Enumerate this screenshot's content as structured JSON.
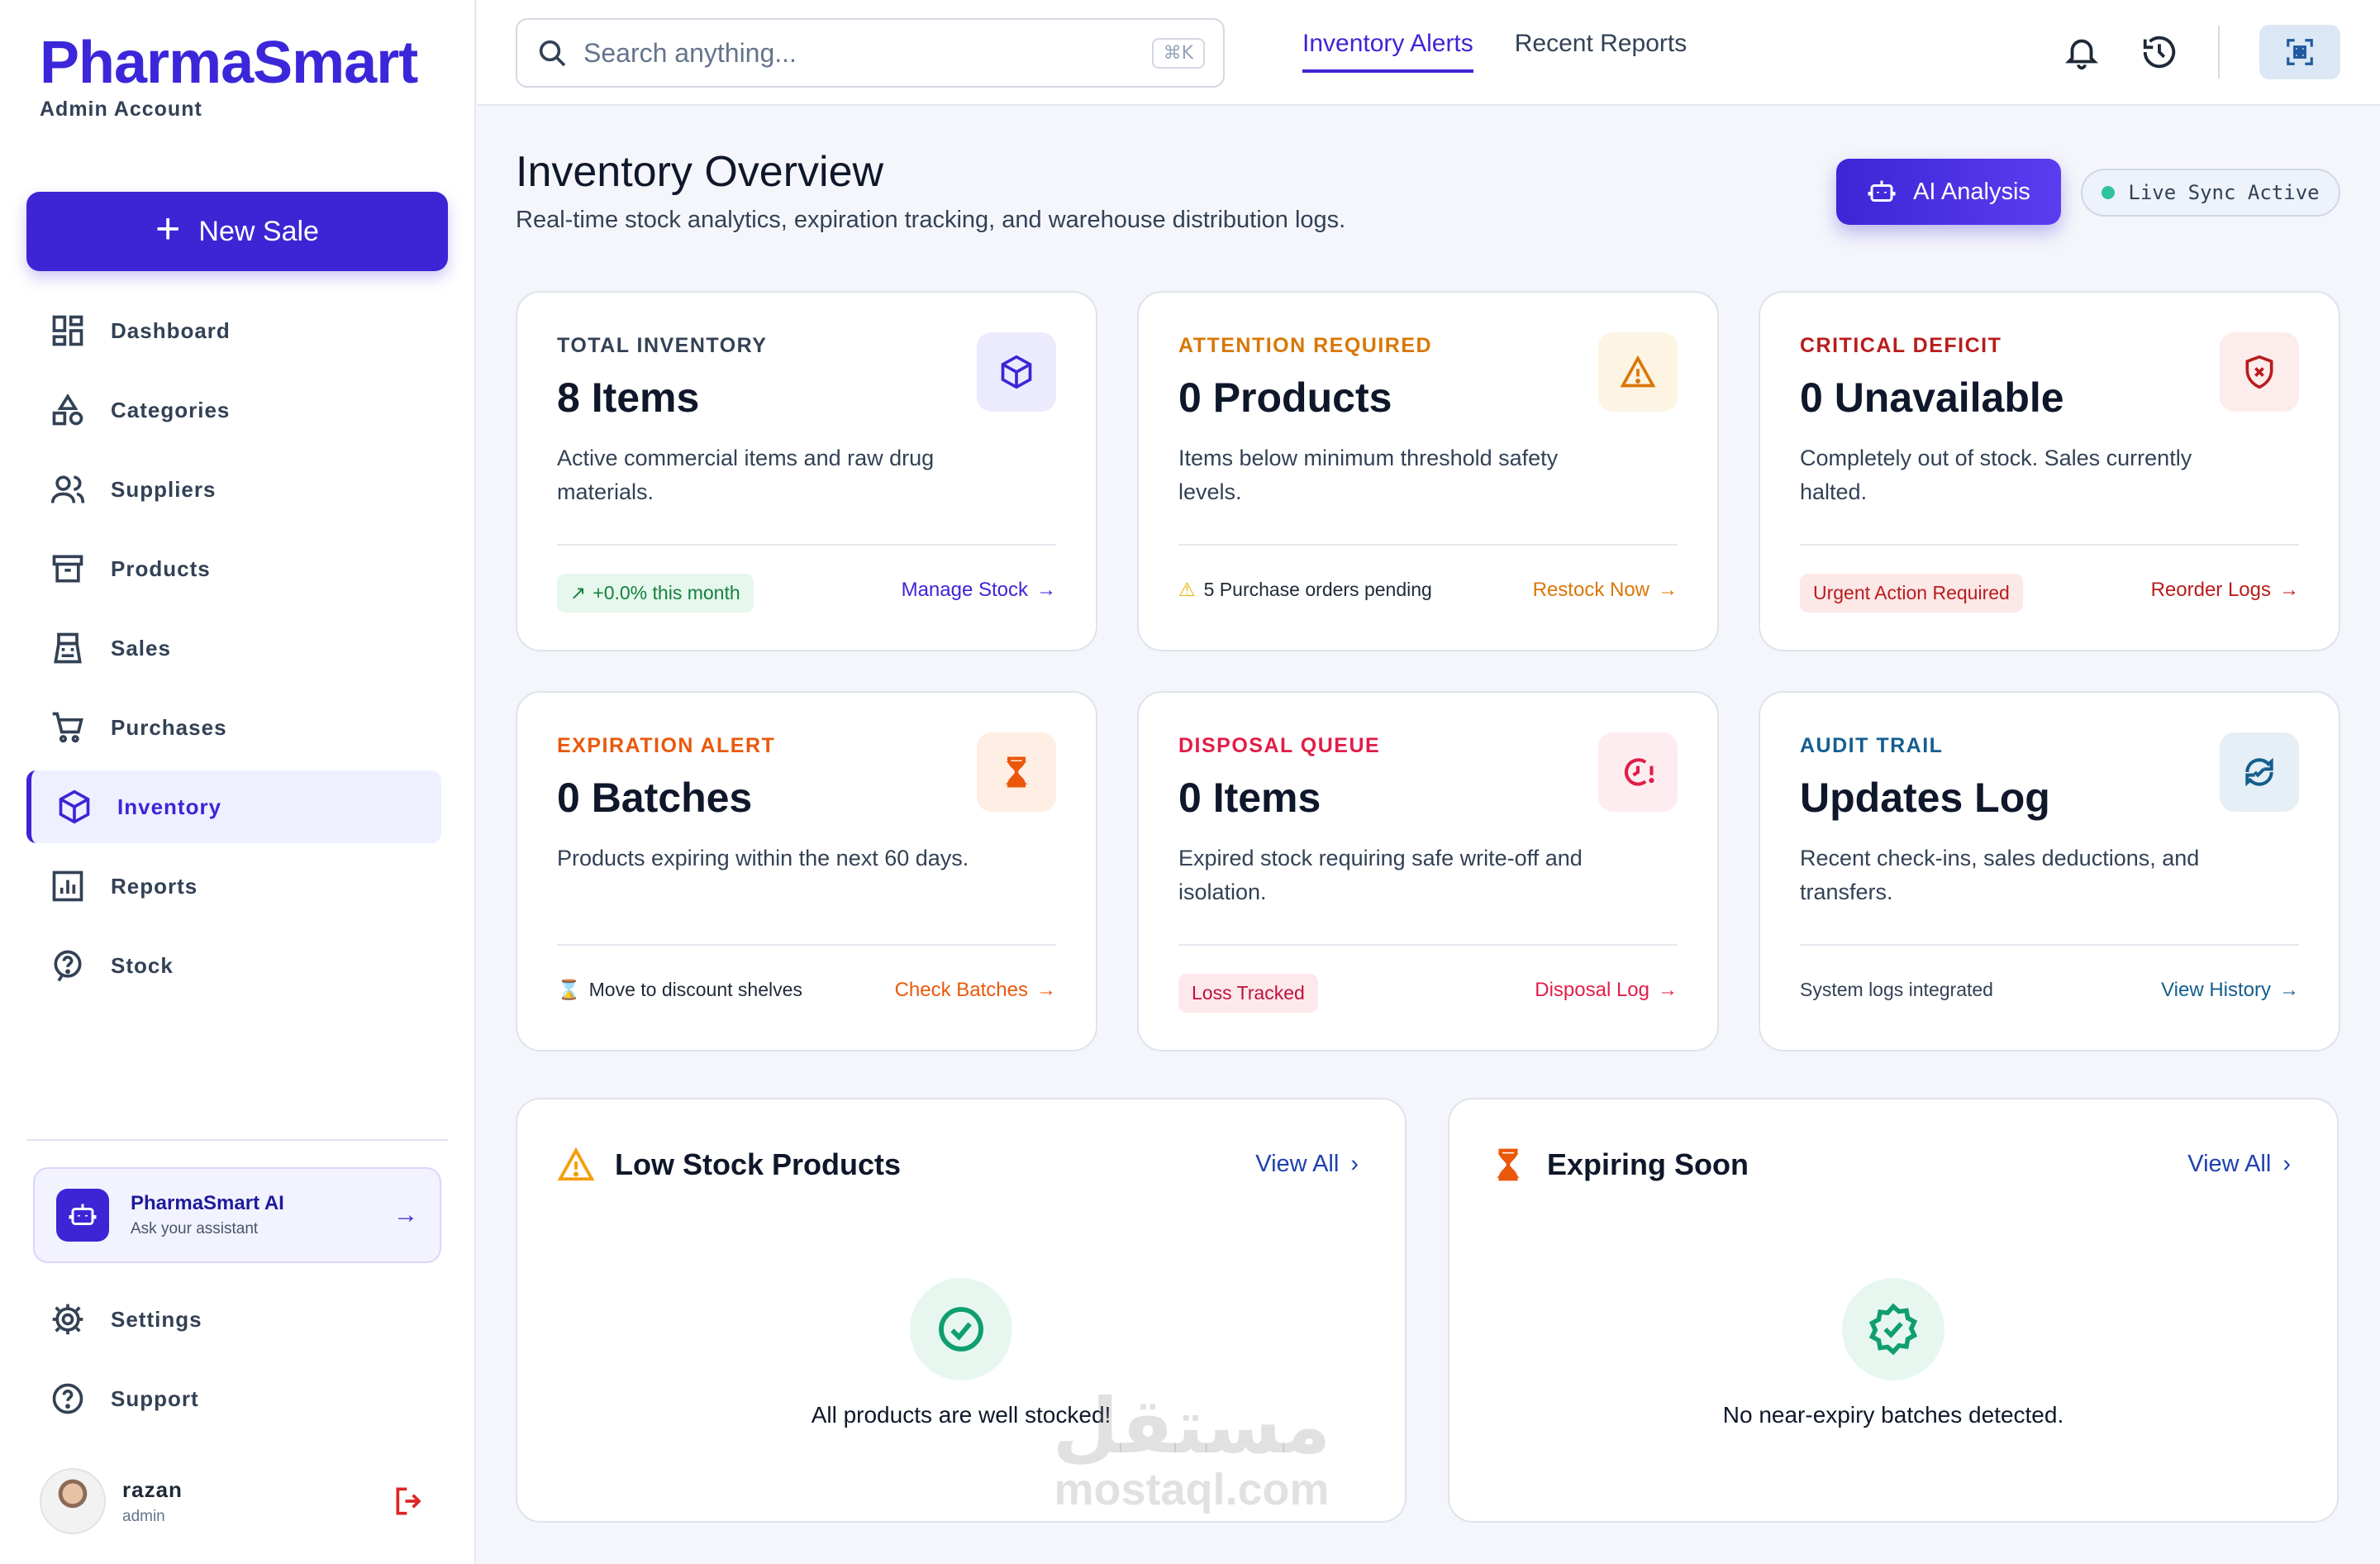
{
  "brand": {
    "name": "PharmaSmart",
    "account": "Admin Account"
  },
  "sidebar": {
    "new_sale": "New Sale",
    "items": [
      {
        "label": "Dashboard",
        "icon": "dashboard-icon"
      },
      {
        "label": "Categories",
        "icon": "categories-icon"
      },
      {
        "label": "Suppliers",
        "icon": "suppliers-icon"
      },
      {
        "label": "Products",
        "icon": "products-icon"
      },
      {
        "label": "Sales",
        "icon": "sales-icon"
      },
      {
        "label": "Purchases",
        "icon": "cart-icon"
      },
      {
        "label": "Inventory",
        "icon": "box-icon",
        "active": true
      },
      {
        "label": "Reports",
        "icon": "reports-icon"
      },
      {
        "label": "Stock",
        "icon": "help-icon"
      }
    ],
    "ai_assistant": {
      "title": "PharmaSmart AI",
      "subtitle": "Ask your assistant"
    },
    "bottom_items": [
      {
        "label": "Settings",
        "icon": "gear-icon"
      },
      {
        "label": "Support",
        "icon": "question-icon"
      }
    ],
    "user": {
      "name": "razan",
      "role": "admin"
    }
  },
  "topbar": {
    "search_placeholder": "Search anything...",
    "shortcut": "⌘K",
    "tabs": [
      {
        "label": "Inventory Alerts",
        "active": true
      },
      {
        "label": "Recent Reports",
        "active": false
      }
    ]
  },
  "header": {
    "title": "Inventory Overview",
    "subtitle": "Real-time stock analytics, expiration tracking, and warehouse distribution logs.",
    "ai_button": "AI Analysis",
    "live_status": "Live Sync Active"
  },
  "cards": [
    {
      "label": "TOTAL INVENTORY",
      "value": "8 Items",
      "desc": "Active commercial items and raw drug materials.",
      "foot_left": "+0.0% this month",
      "foot_right": "Manage Stock",
      "accent": "#3d25d6",
      "icon": "cube-icon"
    },
    {
      "label": "ATTENTION REQUIRED",
      "value": "0 Products",
      "desc": "Items below minimum threshold safety levels.",
      "foot_left": "5 Purchase orders pending",
      "foot_right": "Restock Now",
      "accent": "#d97706",
      "icon": "warning-icon"
    },
    {
      "label": "CRITICAL DEFICIT",
      "value": "0 Unavailable",
      "desc": "Completely out of stock. Sales currently halted.",
      "foot_left": "Urgent Action Required",
      "foot_right": "Reorder Logs",
      "accent": "#b91c1c",
      "icon": "shield-x-icon"
    },
    {
      "label": "EXPIRATION ALERT",
      "value": "0 Batches",
      "desc": "Products expiring within the next 60 days.",
      "foot_left": "Move to discount shelves",
      "foot_right": "Check Batches",
      "accent": "#ea580c",
      "icon": "hourglass-icon"
    },
    {
      "label": "DISPOSAL QUEUE",
      "value": "0 Items",
      "desc": "Expired stock requiring safe write-off and isolation.",
      "foot_left": "Loss Tracked",
      "foot_right": "Disposal Log",
      "accent": "#e11d48",
      "icon": "clock-alert-icon"
    },
    {
      "label": "AUDIT TRAIL",
      "value": "Updates Log",
      "desc": "Recent check-ins, sales deductions, and transfers.",
      "foot_left": "System logs integrated",
      "foot_right": "View History",
      "accent": "#155e8f",
      "icon": "sync-check-icon"
    }
  ],
  "panels": [
    {
      "title": "Low Stock Products",
      "view_all": "View All",
      "empty": "All products are well stocked!",
      "icon": "warning-icon"
    },
    {
      "title": "Expiring Soon",
      "view_all": "View All",
      "empty": "No near-expiry batches detected.",
      "icon": "hourglass-icon"
    }
  ],
  "watermark": {
    "arabic": "مستقل",
    "latin": "mostaql.com"
  }
}
